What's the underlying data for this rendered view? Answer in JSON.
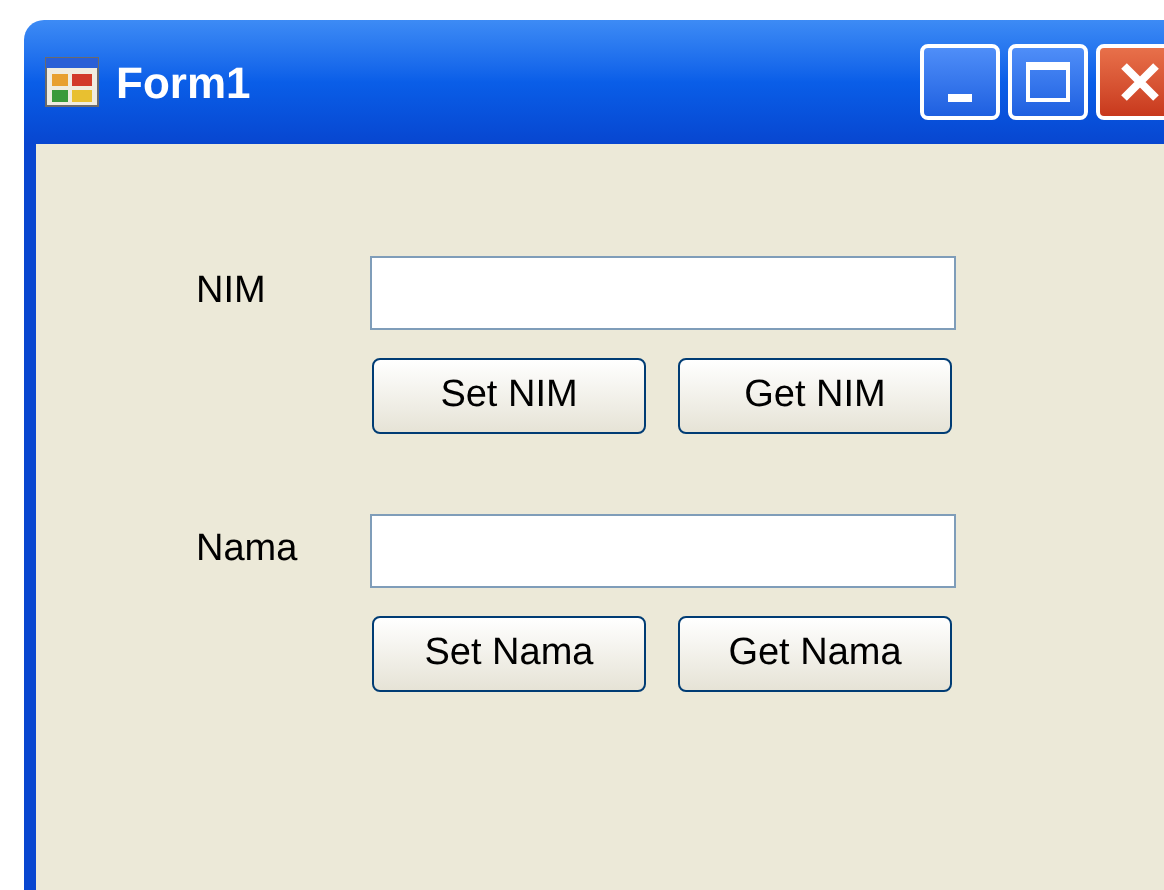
{
  "window": {
    "title": "Form1"
  },
  "groups": [
    {
      "label": "NIM",
      "buttons": [
        "Set NIM",
        "Get NIM"
      ]
    },
    {
      "label": "Nama",
      "buttons": [
        "Set Nama",
        "Get Nama"
      ]
    }
  ]
}
